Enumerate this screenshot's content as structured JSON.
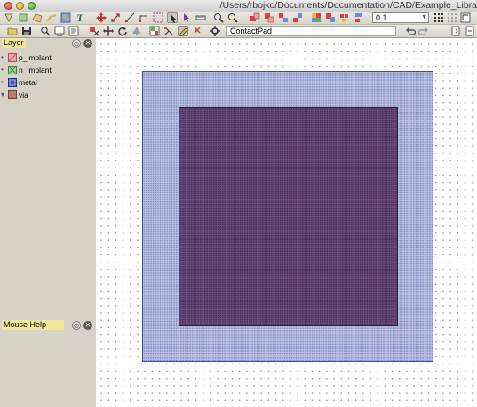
{
  "window": {
    "title": "/Users/rbojko/Documents/Documentation/CAD/Example_Libra"
  },
  "toolbar": {
    "zoom_value": "0.1",
    "cell_name": "ContactPad"
  },
  "layer_panel": {
    "title": "Layer",
    "layers": [
      {
        "name": "p_implant",
        "color": "#e8a7a7"
      },
      {
        "name": "n_implant",
        "color": "#9fd59f"
      },
      {
        "name": "metal",
        "color": "#3f55b7"
      },
      {
        "name": "via",
        "color": "#b47d6d"
      }
    ]
  },
  "mouse_help_panel": {
    "title": "Mouse Help"
  },
  "colors": {
    "panel_title_highlight": "#f3e79c",
    "via_fill": "#b9bfe0",
    "metal_fill": "#6a4b7c"
  }
}
